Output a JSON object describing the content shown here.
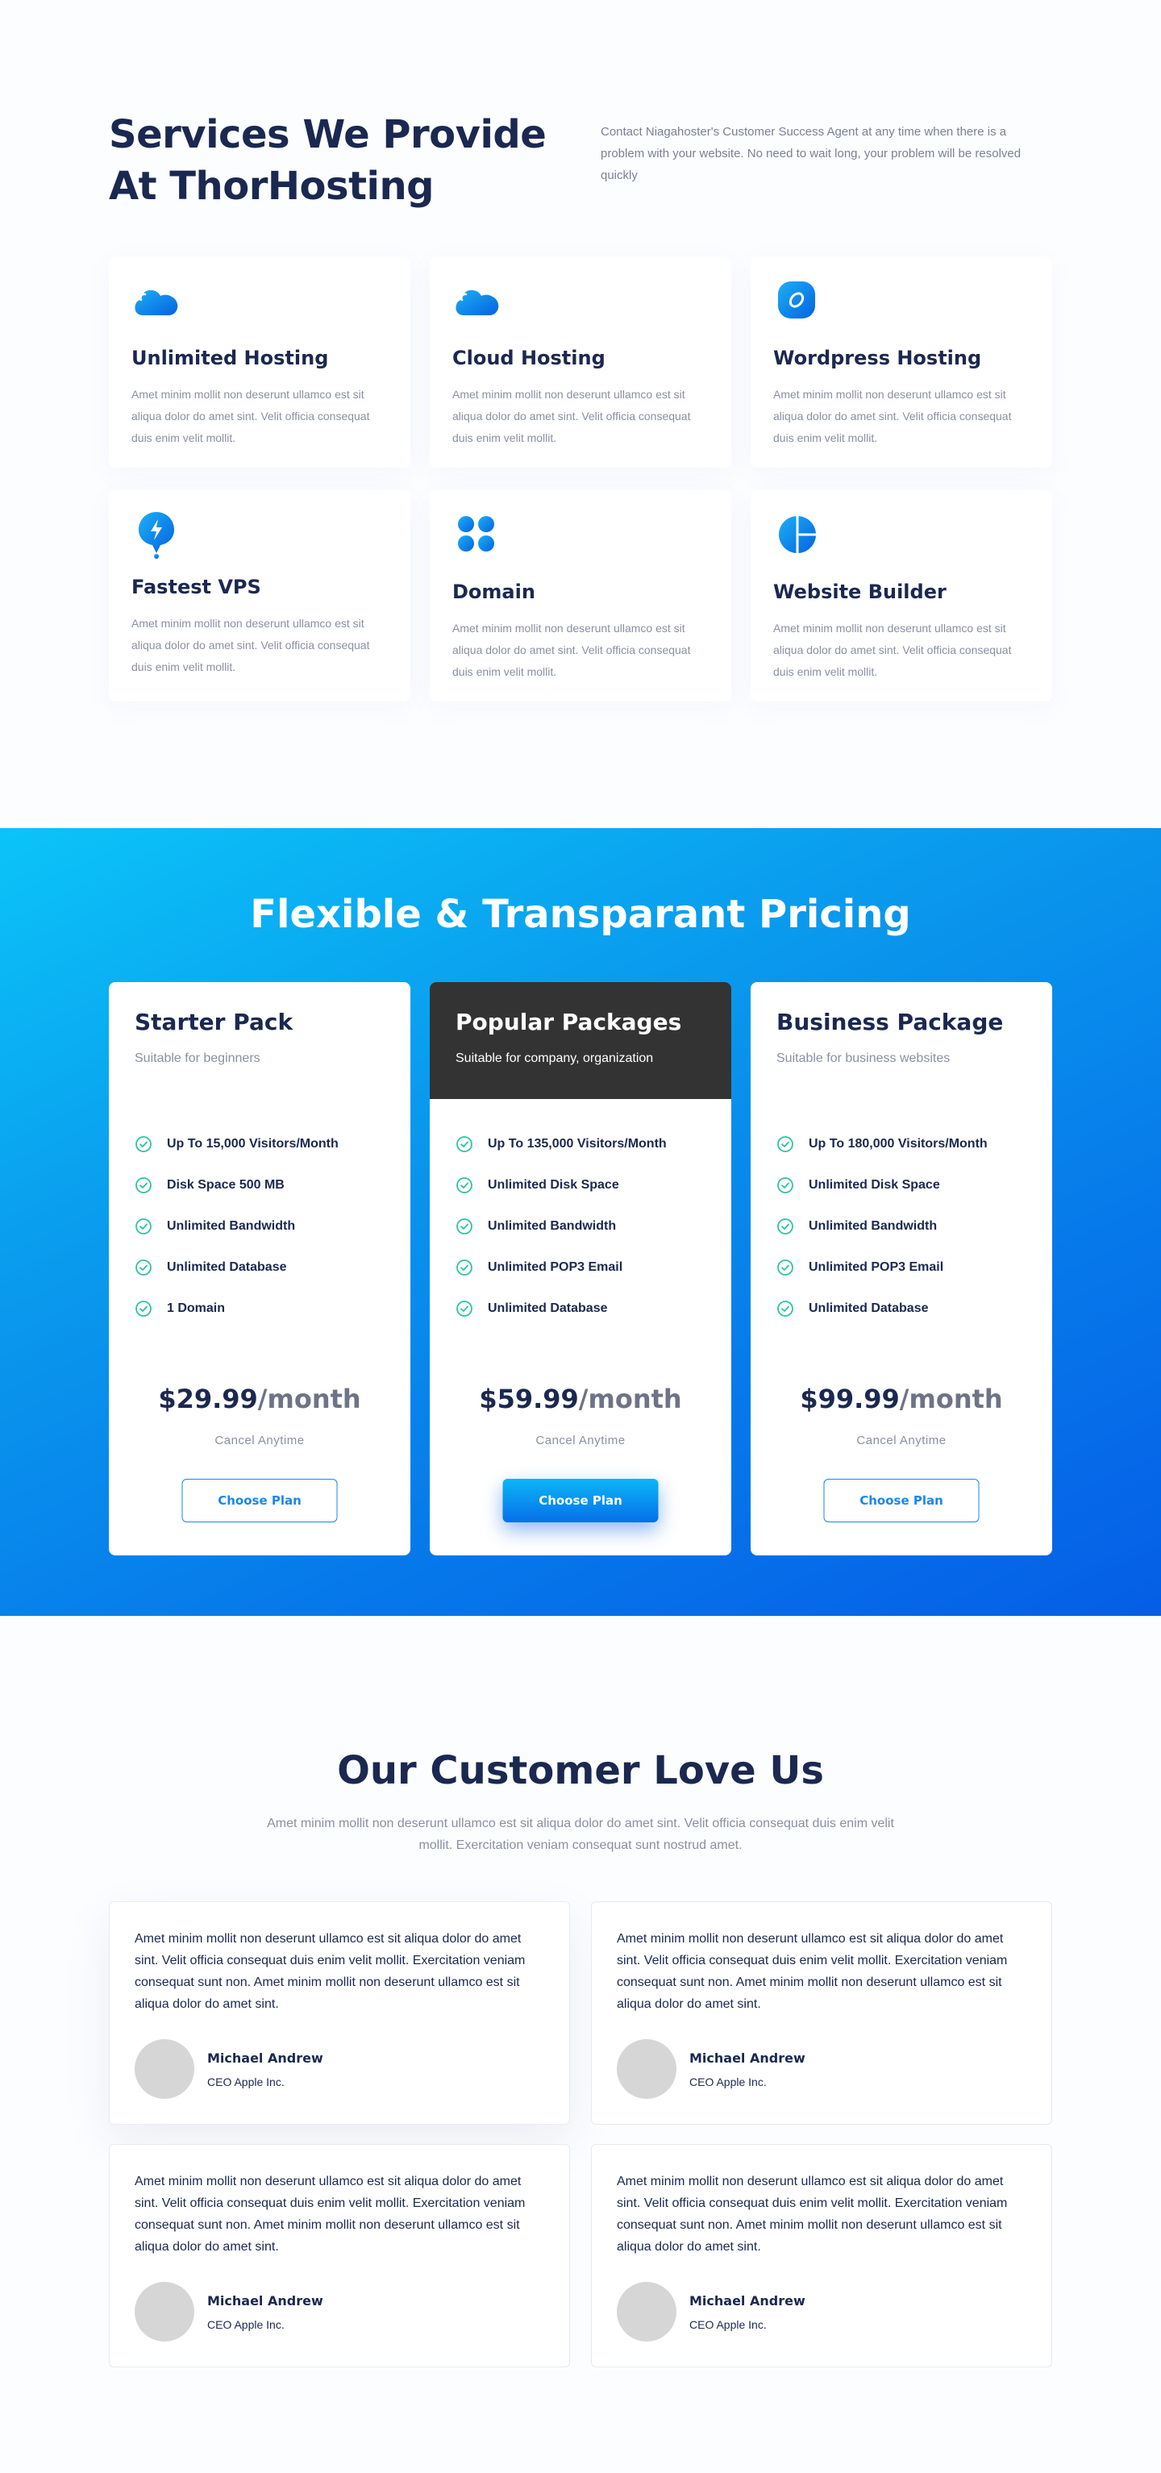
{
  "services": {
    "title": "Services We Provide At ThorHosting",
    "description": "Contact Niagahoster's Customer Success Agent at any time when there is a problem with your website. No need to wait long, your problem will be resolved quickly",
    "items": [
      {
        "title": "Unlimited Hosting",
        "text": "Amet minim mollit non deserunt ullamco est sit aliqua dolor do amet sint. Velit officia consequat duis enim velit mollit.",
        "icon": "cloud-icon"
      },
      {
        "title": "Cloud Hosting",
        "text": "Amet minim mollit non deserunt ullamco est sit aliqua dolor do amet sint. Velit officia consequat duis enim velit mollit.",
        "icon": "cloud-icon"
      },
      {
        "title": "Wordpress Hosting",
        "text": "Amet minim mollit non deserunt ullamco est sit aliqua dolor do amet sint. Velit officia consequat duis enim velit mollit.",
        "icon": "wordpress-icon"
      },
      {
        "title": "Fastest VPS",
        "text": "Amet minim mollit non deserunt ullamco est sit aliqua dolor do amet sint. Velit officia consequat duis enim velit mollit.",
        "icon": "lightning-pin-icon"
      },
      {
        "title": "Domain",
        "text": "Amet minim mollit non deserunt ullamco est sit aliqua dolor do amet sint. Velit officia consequat duis enim velit mollit.",
        "icon": "grid-dots-icon"
      },
      {
        "title": "Website Builder",
        "text": "Amet minim mollit non deserunt ullamco est sit aliqua dolor do amet sint. Velit officia consequat duis enim velit mollit.",
        "icon": "pie-icon"
      }
    ]
  },
  "pricing": {
    "title": "Flexible & Transparant Pricing",
    "plans": [
      {
        "name": "Starter Pack",
        "subtitle": "Suitable for beginners",
        "features": [
          "Up To 15,000 Visitors/Month",
          "Disk Space 500 MB",
          "Unlimited Bandwidth",
          "Unlimited Database",
          "1 Domain"
        ],
        "price": "$29.99",
        "period": "/month",
        "note": "Cancel Anytime",
        "cta": "Choose Plan"
      },
      {
        "name": "Popular Packages",
        "subtitle": "Suitable for company, organization",
        "features": [
          "Up To 135,000 Visitors/Month",
          "Unlimited Disk Space",
          "Unlimited Bandwidth",
          "Unlimited POP3 Email",
          "Unlimited Database"
        ],
        "price": "$59.99",
        "period": "/month",
        "note": "Cancel Anytime",
        "cta": "Choose Plan"
      },
      {
        "name": "Business Package",
        "subtitle": "Suitable for business websites",
        "features": [
          "Up To 180,000 Visitors/Month",
          "Unlimited Disk Space",
          "Unlimited Bandwidth",
          "Unlimited POP3 Email",
          "Unlimited Database"
        ],
        "price": "$99.99",
        "period": "/month",
        "note": "Cancel Anytime",
        "cta": "Choose Plan"
      }
    ]
  },
  "testimonials": {
    "title": "Our Customer Love Us",
    "description": "Amet minim mollit non deserunt ullamco est sit aliqua dolor do amet sint. Velit officia consequat duis enim velit mollit. Exercitation veniam consequat sunt nostrud amet.",
    "items": [
      {
        "quote": "Amet minim mollit non deserunt ullamco est sit aliqua dolor do amet sint. Velit officia consequat duis enim velit mollit. Exercitation veniam consequat sunt non. Amet minim mollit non deserunt ullamco est sit aliqua dolor do amet sint.",
        "name": "Michael Andrew",
        "role": "CEO Apple Inc."
      },
      {
        "quote": "Amet minim mollit non deserunt ullamco est sit aliqua dolor do amet sint. Velit officia consequat duis enim velit mollit. Exercitation veniam consequat sunt non. Amet minim mollit non deserunt ullamco est sit aliqua dolor do amet sint.",
        "name": "Michael Andrew",
        "role": "CEO Apple Inc."
      },
      {
        "quote": "Amet minim mollit non deserunt ullamco est sit aliqua dolor do amet sint. Velit officia consequat duis enim velit mollit. Exercitation veniam consequat sunt non. Amet minim mollit non deserunt ullamco est sit aliqua dolor do amet sint.",
        "name": "Michael Andrew",
        "role": "CEO Apple Inc."
      },
      {
        "quote": "Amet minim mollit non deserunt ullamco est sit aliqua dolor do amet sint. Velit officia consequat duis enim velit mollit. Exercitation veniam consequat sunt non. Amet minim mollit non deserunt ullamco est sit aliqua dolor do amet sint.",
        "name": "Michael Andrew",
        "role": "CEO Apple Inc."
      }
    ]
  },
  "colors": {
    "primary_blue": "#0a8cf0",
    "dark_navy": "#1b2850",
    "muted_text": "#8a90a2",
    "check_green": "#2ec4a0",
    "featured_header": "#333333"
  }
}
